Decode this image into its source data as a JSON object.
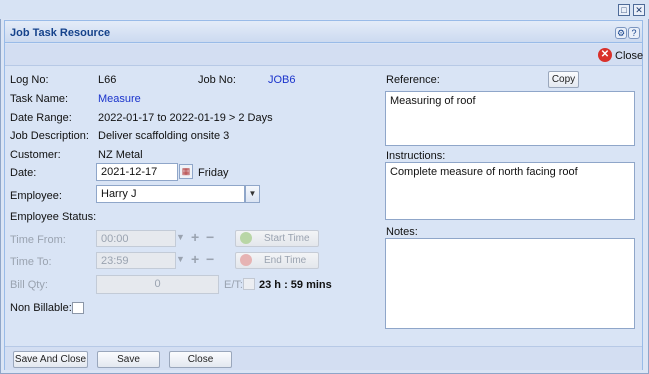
{
  "window": {
    "title": "Job Task Resource",
    "restore_icon": "□",
    "close_icon": "✕"
  },
  "toolbar": {
    "gear_icon": "⚙",
    "help_icon": "?",
    "close_label": "Close"
  },
  "form": {
    "log_no_label": "Log No:",
    "log_no_value": "L66",
    "job_no_label": "Job No:",
    "job_no_value": "JOB6",
    "task_name_label": "Task Name:",
    "task_name_value": "Measure",
    "date_range_label": "Date Range:",
    "date_range_value": "2022-01-17 to 2022-01-19 > 2 Days",
    "job_description_label": "Job Description:",
    "job_description_value": "Deliver scaffolding onsite 3",
    "customer_label": "Customer:",
    "customer_value": "NZ Metal",
    "date_label": "Date:",
    "date_value": "2021-12-17",
    "date_day": "Friday",
    "employee_label": "Employee:",
    "employee_value": "Harry J",
    "employee_status_label": "Employee Status:",
    "time_from_label": "Time From:",
    "time_from_value": "00:00",
    "start_time_label": "Start Time",
    "time_to_label": "Time To:",
    "time_to_value": "23:59",
    "end_time_label": "End Time",
    "bill_qty_label": "Bill Qty:",
    "bill_qty_value": "0",
    "et_label": "E/T:",
    "et_value": "23 h : 59 mins",
    "non_billable_label": "Non Billable:"
  },
  "right": {
    "reference_label": "Reference:",
    "copy_label": "Copy",
    "reference_value": "Measuring of roof",
    "instructions_label": "Instructions:",
    "instructions_value": "Complete measure of north facing roof",
    "notes_label": "Notes:",
    "notes_value": ""
  },
  "footer": {
    "save_and_close": "Save And Close",
    "save": "Save",
    "close": "Close"
  },
  "colors": {
    "accent": "#15428b",
    "link": "#1a33cc",
    "close_red": "#d9302a"
  }
}
